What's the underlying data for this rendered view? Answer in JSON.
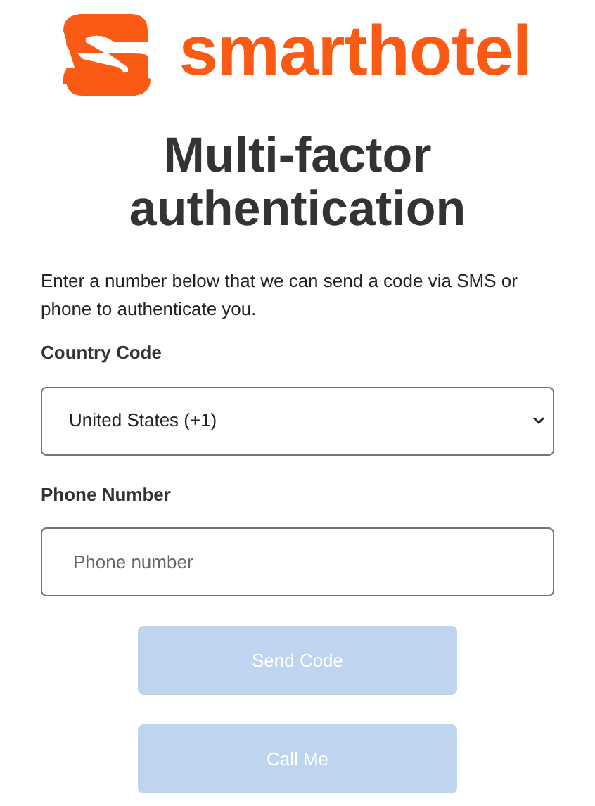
{
  "brand": {
    "name": "smarthotel"
  },
  "title": "Multi-factor authentication",
  "description": "Enter a number below that we can send a code via SMS or phone to authenticate you.",
  "country_code": {
    "label": "Country Code",
    "value": "United States (+1)"
  },
  "phone_number": {
    "label": "Phone Number",
    "placeholder": "Phone number"
  },
  "buttons": [
    {
      "label": "Send Code",
      "disabled": true
    },
    {
      "label": "Call Me",
      "disabled": true
    }
  ]
}
